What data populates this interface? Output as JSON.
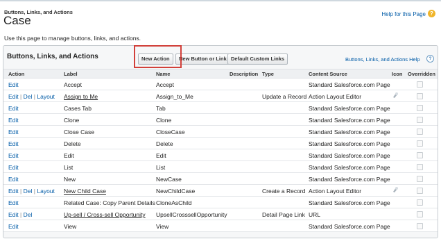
{
  "header": {
    "breadcrumb": "Buttons, Links, and Actions",
    "title": "Case",
    "help_link": "Help for this Page",
    "help_badge": "?",
    "description": "Use this page to manage buttons, links, and actions."
  },
  "panel": {
    "title": "Buttons, Links, and Actions",
    "new_action_label": "New Action",
    "new_button_label": "New Button or Link",
    "default_links_label": "Default Custom Links",
    "help_link": "Buttons, Links, and Actions Help",
    "help_icon": "?"
  },
  "columns": {
    "action": "Action",
    "label": "Label",
    "name": "Name",
    "description": "Description",
    "type": "Type",
    "source": "Content Source",
    "icon": "Icon",
    "overridden": "Overridden"
  },
  "actions_text": {
    "edit": "Edit",
    "del": "Del",
    "layout": "Layout",
    "sep": "|"
  },
  "rows": [
    {
      "actions": [
        "Edit"
      ],
      "label": "Accept",
      "name": "Accept",
      "description": "",
      "type": "",
      "source": "Standard Salesforce.com Page",
      "underline": false,
      "icon": ""
    },
    {
      "actions": [
        "Edit",
        "Del",
        "Layout"
      ],
      "label": "Assign to Me",
      "name": "Assign_to_Me",
      "description": "",
      "type": "Update a Record",
      "source": "Action Layout Editor",
      "underline": true,
      "icon": "action-icon"
    },
    {
      "actions": [
        "Edit"
      ],
      "label": "Cases Tab",
      "name": "Tab",
      "description": "",
      "type": "",
      "source": "Standard Salesforce.com Page",
      "underline": false,
      "icon": ""
    },
    {
      "actions": [
        "Edit"
      ],
      "label": "Clone",
      "name": "Clone",
      "description": "",
      "type": "",
      "source": "Standard Salesforce.com Page",
      "underline": false,
      "icon": ""
    },
    {
      "actions": [
        "Edit"
      ],
      "label": "Close Case",
      "name": "CloseCase",
      "description": "",
      "type": "",
      "source": "Standard Salesforce.com Page",
      "underline": false,
      "icon": ""
    },
    {
      "actions": [
        "Edit"
      ],
      "label": "Delete",
      "name": "Delete",
      "description": "",
      "type": "",
      "source": "Standard Salesforce.com Page",
      "underline": false,
      "icon": ""
    },
    {
      "actions": [
        "Edit"
      ],
      "label": "Edit",
      "name": "Edit",
      "description": "",
      "type": "",
      "source": "Standard Salesforce.com Page",
      "underline": false,
      "icon": ""
    },
    {
      "actions": [
        "Edit"
      ],
      "label": "List",
      "name": "List",
      "description": "",
      "type": "",
      "source": "Standard Salesforce.com Page",
      "underline": false,
      "icon": ""
    },
    {
      "actions": [
        "Edit"
      ],
      "label": "New",
      "name": "NewCase",
      "description": "",
      "type": "",
      "source": "Standard Salesforce.com Page",
      "underline": false,
      "icon": ""
    },
    {
      "actions": [
        "Edit",
        "Del",
        "Layout"
      ],
      "label": "New Child Case",
      "name": "NewChildCase",
      "description": "",
      "type": "Create a Record",
      "source": "Action Layout Editor",
      "underline": true,
      "icon": "action-icon"
    },
    {
      "actions": [
        "Edit"
      ],
      "label": "Related Case: Copy Parent Details",
      "name": "CloneAsChild",
      "description": "",
      "type": "",
      "source": "Standard Salesforce.com Page",
      "underline": false,
      "icon": ""
    },
    {
      "actions": [
        "Edit",
        "Del"
      ],
      "label": "Up-sell / Cross-sell Opportunity",
      "name": "UpsellCrosssellOpportunity",
      "description": "",
      "type": "Detail Page Link",
      "source": "URL",
      "underline": true,
      "icon": ""
    },
    {
      "actions": [
        "Edit"
      ],
      "label": "View",
      "name": "View",
      "description": "",
      "type": "",
      "source": "Standard Salesforce.com Page",
      "underline": false,
      "icon": ""
    }
  ],
  "colors": {
    "link": "#015ba7",
    "highlight": "#d2403a",
    "help_badge": "#f0b52a"
  }
}
